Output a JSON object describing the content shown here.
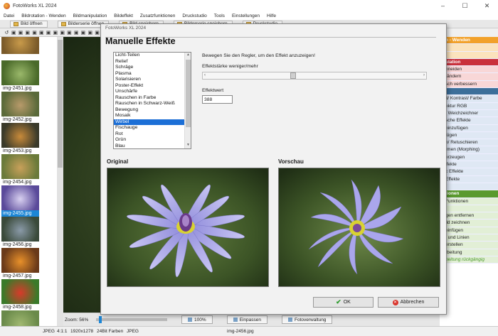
{
  "window": {
    "title": "FotoWorks XL 2024",
    "controls": [
      "–",
      "☐",
      "✕"
    ]
  },
  "menu": [
    "Datei",
    "Bildrotation - Wenden",
    "Bildmanipulation",
    "Bildeffekt",
    "Zusatzfunktionen",
    "Druckstudio",
    "Tools",
    "Einstellungen",
    "Hilfe"
  ],
  "toolbar": [
    "Bild öffnen",
    "Bilderserie öffnen",
    "Bild speichern",
    "Bilderserie speichern",
    "Druckstudio"
  ],
  "thumbnails": [
    {
      "label": "",
      "colors": [
        "#7a5a2a",
        "#c89a4a"
      ]
    },
    {
      "label": "img-2451.jpg",
      "colors": [
        "#4a6a2a",
        "#9ab86a"
      ]
    },
    {
      "label": "img-2452.jpg",
      "colors": [
        "#5a6a3a",
        "#b89a6a"
      ]
    },
    {
      "label": "img-2453.jpg",
      "colors": [
        "#3a3a2a",
        "#c88a3a"
      ]
    },
    {
      "label": "img-2454.jpg",
      "colors": [
        "#6a7a3a",
        "#c8a05a"
      ]
    },
    {
      "label": "img-2455.jpg",
      "colors": [
        "#5a4a9a",
        "#d8d0f0"
      ]
    },
    {
      "label": "img-2456.jpg",
      "colors": [
        "#3a4a3a",
        "#8a9aa8"
      ]
    },
    {
      "label": "img-2457.jpg",
      "colors": [
        "#6a3a1a",
        "#e8902a"
      ]
    },
    {
      "label": "img-2458.jpg",
      "colors": [
        "#3a7a2a",
        "#d83a2a"
      ]
    },
    {
      "label": "img-2459.jpg",
      "colors": [
        "#6a8a4a",
        "#a0b870"
      ]
    }
  ],
  "selected_thumb_index": 5,
  "dialog": {
    "window_title": "FotoWorks XL 2024",
    "heading": "Manuelle Effekte",
    "instruction": "Bewegen Sie den Regler, um den Effekt anzuzeigen!",
    "strength_label": "Effektstärke weniger/mehr",
    "value_label": "Effektwert",
    "value": "388",
    "slider_level": 0.39,
    "effects": [
      "Licht-Teilen",
      "Relief",
      "Schräge",
      "Plasma",
      "Solarisieren",
      "Poster-Effekt",
      "Unschärfe",
      "Rauschen in Farbe",
      "Rauschen in Schwarz-Weiß",
      "Bewegung",
      "Mosaik",
      "Wirbel",
      "Fischauge",
      "Rot",
      "Grün",
      "Blau"
    ],
    "selected_effect": "Wirbel",
    "original_label": "Original",
    "preview_label": "Vorschau",
    "ok_label": "OK",
    "cancel_label": "Abbrechen"
  },
  "right_panel": [
    {
      "text": "n - Wenden",
      "style": "head-orange"
    },
    {
      "text": "",
      "style": "orange"
    },
    {
      "text": "",
      "style": "orange"
    },
    {
      "text": "ulation",
      "style": "head-red"
    },
    {
      "text": "hneiden",
      "style": "pink"
    },
    {
      "text": "rändern",
      "style": "pink"
    },
    {
      "text": "sch verbessern",
      "style": "pink"
    },
    {
      "text": "",
      "style": "head-blue"
    },
    {
      "text": "it/ Kontrast/ Farbe",
      "style": "blue"
    },
    {
      "text": "ektur RGB",
      "style": "blue"
    },
    {
      "text": "/ Weichzeichner",
      "style": "blue"
    },
    {
      "text": "sche Effekte",
      "style": "blue"
    },
    {
      "text": "hinzufügen",
      "style": "blue"
    },
    {
      "text": "fügen",
      "style": "blue"
    },
    {
      "text": "n/ Retuschieren",
      "style": "blue"
    },
    {
      "text": "rmen (Morphing)",
      "style": "blue"
    },
    {
      "text": "erzeugen",
      "style": "blue"
    },
    {
      "text": "ffekte",
      "style": "blue"
    },
    {
      "text": "x Effekte",
      "style": "blue"
    },
    {
      "text": "Effekte",
      "style": "blue"
    },
    {
      "text": "",
      "style": "blue"
    },
    {
      "text": "tionen",
      "style": "head-green"
    },
    {
      "text": "Funktionen",
      "style": "green"
    },
    {
      "text": "",
      "style": "green"
    },
    {
      "text": "gen entfernen",
      "style": "green"
    },
    {
      "text": "ild zeichnen",
      "style": "green"
    },
    {
      "text": "einfügen",
      "style": "green"
    },
    {
      "text": "t und Linien",
      "style": "green"
    },
    {
      "text": "erstellen",
      "style": "green"
    },
    {
      "text": "rbeitung",
      "style": "green"
    },
    {
      "text": "beitung rückgängig",
      "style": "undo"
    }
  ],
  "bottom": {
    "zoom": "Zoom: 56%",
    "zoom_level": 0.04,
    "btn_100": "100%",
    "btn_fit": "Einpassen",
    "btn_folder": "Fotoverwaltung"
  },
  "status": {
    "type": "JPEG",
    "ratio": "4:1:1",
    "size": "1920x1278",
    "colors": "24Bit Farben",
    "format": "JPEG",
    "file": "img-2456.jpg"
  }
}
